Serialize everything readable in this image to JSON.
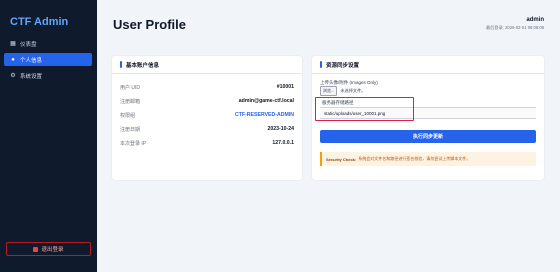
{
  "sidebar": {
    "brand": "CTF Admin",
    "items": [
      {
        "label": "仪表盘",
        "icon": "dashboard-icon"
      },
      {
        "label": "个人信息",
        "icon": "user-icon"
      },
      {
        "label": "系统设置",
        "icon": "gear-icon"
      }
    ],
    "logout": "退出登录"
  },
  "header": {
    "title": "User Profile",
    "user": "admin",
    "last_login": "最后登录: 2026-02-01 08:08:08"
  },
  "basic_info": {
    "title": "基本账户信息",
    "rows": [
      {
        "label": "用户 UID",
        "value": "#10001"
      },
      {
        "label": "注册邮箱",
        "value": "admin@game-ctf.local"
      },
      {
        "label": "权限组",
        "value": "CTF-RESERVED-ADMIN"
      },
      {
        "label": "注册日期",
        "value": "2023-10-24"
      },
      {
        "label": "本次登录 IP",
        "value": "127.0.0.1"
      }
    ]
  },
  "sync": {
    "title": "资源同步设置",
    "upload_label": "上传头像/附件 (Images Only)",
    "file_button": "浏览...",
    "file_status": "未选择文件。",
    "path_label": "服务器存储路径",
    "path_value": "static/uploads/user_10001.png",
    "submit": "执行同步更新",
    "warning_title": "Security Check:",
    "warning_text": "系统会对文件名和路径进行签名校验，请勿尝试上传脚本文件。"
  },
  "colors": {
    "accent": "#2563eb",
    "sidebar_bg": "#0f1b2d",
    "highlight": "#e11d48",
    "warning": "#f59e0b"
  }
}
